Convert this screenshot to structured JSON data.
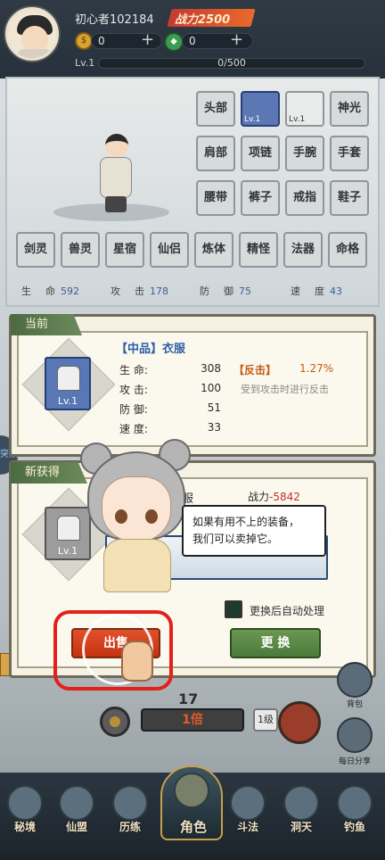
{
  "player": {
    "name": "初心者102184",
    "power": "战力2500",
    "currency1": "0",
    "currency2": "0",
    "level": "Lv.1",
    "exp": "0/500"
  },
  "equip_slots": {
    "row1": [
      "头部",
      "",
      "",
      "神光"
    ],
    "row1_lv": [
      "",
      "Lv.1",
      "Lv.1",
      ""
    ],
    "row2": [
      "肩部",
      "项链",
      "手腕",
      "手套"
    ],
    "row3": [
      "腰带",
      "裤子",
      "戒指",
      "鞋子"
    ],
    "row4": [
      "剑灵",
      "兽灵",
      "星宿",
      "仙侣",
      "炼体",
      "精怪",
      "法器",
      "命格"
    ]
  },
  "stats": [
    {
      "label": "生命",
      "value": "592"
    },
    {
      "label": "攻击",
      "value": "178"
    },
    {
      "label": "防御",
      "value": "75"
    },
    {
      "label": "速度",
      "value": "43"
    }
  ],
  "current_item": {
    "tab": "当前",
    "name": "【中品】衣服",
    "lv": "Lv.1",
    "stats": [
      {
        "label": "生 命:",
        "value": "308"
      },
      {
        "label": "攻 击:",
        "value": "100"
      },
      {
        "label": "防 御:",
        "value": "51"
      },
      {
        "label": "速 度:",
        "value": "33"
      }
    ],
    "special_name": "【反击】",
    "special_pct": "1.27%",
    "special_desc": "受到攻击时进行反击"
  },
  "new_item": {
    "tab": "新获得",
    "name_partial": "服",
    "lv": "Lv.1",
    "power_label": "战力",
    "power_value": "-5842",
    "auto_label": "更换后自动处理",
    "sell_label": "出售",
    "replace_label": "更 换"
  },
  "tutorial": {
    "line1": "如果有用不上的装备，",
    "line2": "我们可以卖掉它。"
  },
  "bottom": {
    "number": "17",
    "multiplier": "1倍",
    "level_btn": "1级",
    "bag_label": "背包",
    "share_label": "每日分享",
    "left_tab": "突破"
  },
  "nav": [
    "秘境",
    "仙盟",
    "历练",
    "角色",
    "斗法",
    "洞天",
    "钓鱼"
  ],
  "colors": {
    "accent_red": "#c4302b",
    "item_blue": "#5877b4",
    "button_green": "#6a9852",
    "button_orange": "#e0512a"
  }
}
